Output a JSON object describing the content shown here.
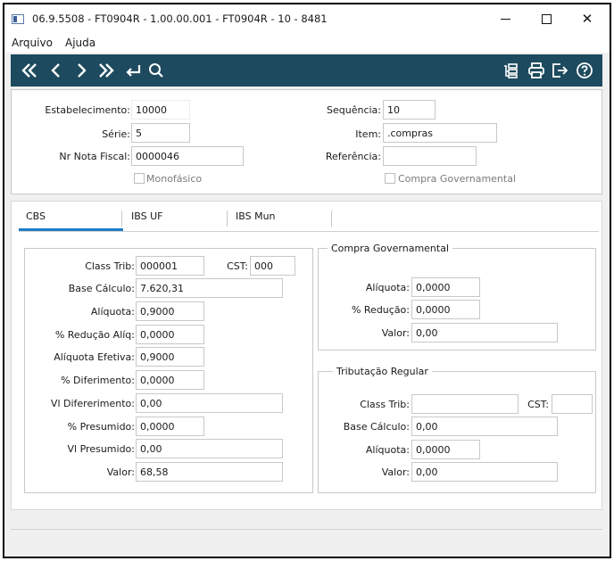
{
  "window": {
    "title": "06.9.5508 - FT0904R - 1.00.00.001 - FT0904R - 10 - 8481",
    "minimize": "–",
    "maximize": "□",
    "close": "✕"
  },
  "menu": {
    "arquivo": "Arquivo",
    "ajuda": "Ajuda"
  },
  "toolbar": {
    "icons": [
      "first-icon",
      "previous-icon",
      "next-icon",
      "last-icon",
      "goto-icon",
      "search-icon",
      "filter-icon",
      "print-icon",
      "exit-icon",
      "help-icon"
    ]
  },
  "header": {
    "estabelecimento_label": "Estabelecimento:",
    "estabelecimento_value": "10000",
    "serie_label": "Série:",
    "serie_value": "5",
    "nr_nota_fiscal_label": "Nr Nota Fiscal:",
    "nr_nota_fiscal_value": "0000046",
    "monofasico_label": "Monofásico",
    "sequencia_label": "Sequência:",
    "sequencia_value": "10",
    "item_label": "Item:",
    "item_value": ".compras",
    "referencia_label": "Referência:",
    "referencia_value": "",
    "compra_gov_label": "Compra Governamental"
  },
  "tabs": [
    "CBS",
    "IBS UF",
    "IBS Mun"
  ],
  "cbs": {
    "class_trib_label": "Class Trib:",
    "class_trib_value": "000001",
    "cst_label": "CST:",
    "cst_value": "000",
    "base_calculo_label": "Base Cálculo:",
    "base_calculo_value": "7.620,31",
    "aliquota_label": "Alíquota:",
    "aliquota_value": "0,9000",
    "reducao_aliq_label": "% Redução Alíq:",
    "reducao_aliq_value": "0,0000",
    "aliquota_efetiva_label": "Alíquota Efetiva:",
    "aliquota_efetiva_value": "0,9000",
    "diferimento_label": "% Diferimento:",
    "diferimento_value": "0,0000",
    "vl_diferimento_label": "Vl Difererimento:",
    "vl_diferimento_value": "0,00",
    "presumido_label": "% Presumido:",
    "presumido_value": "0,0000",
    "vl_presumido_label": "Vl Presumido:",
    "vl_presumido_value": "0,00",
    "valor_label": "Valor:",
    "valor_value": "68,58"
  },
  "compra_governamental": {
    "title": "Compra Governamental",
    "aliquota_label": "Alíquota:",
    "aliquota_value": "0,0000",
    "reducao_label": "% Redução:",
    "reducao_value": "0,0000",
    "valor_label": "Valor:",
    "valor_value": "0,00"
  },
  "tributacao_regular": {
    "title": "Tributação Regular",
    "class_trib_label": "Class Trib:",
    "class_trib_value": "",
    "cst_label": "CST:",
    "cst_value": "",
    "base_calculo_label": "Base Cálculo:",
    "base_calculo_value": "0,00",
    "aliquota_label": "Alíquota:",
    "aliquota_value": "0,0000",
    "valor_label": "Valor:",
    "valor_value": "0,00"
  }
}
